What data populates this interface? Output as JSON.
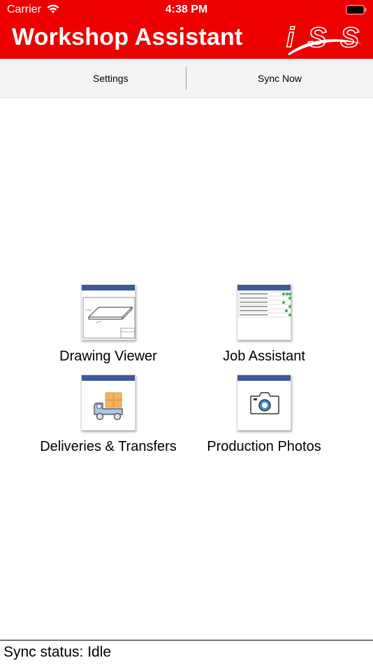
{
  "status_bar": {
    "carrier": "Carrier",
    "time": "4:38 PM"
  },
  "header": {
    "title": "Workshop Assistant",
    "logo_text": "iSS",
    "background": "#ee0000"
  },
  "toolbar": {
    "settings_label": "Settings",
    "sync_label": "Sync Now"
  },
  "tiles": [
    {
      "label": "Drawing Viewer",
      "icon": "drawing-icon"
    },
    {
      "label": "Job Assistant",
      "icon": "job-list-icon"
    },
    {
      "label": "Deliveries & Transfers",
      "icon": "delivery-truck-icon"
    },
    {
      "label": "Production Photos",
      "icon": "camera-icon"
    }
  ],
  "footer": {
    "sync_status": "Sync status: Idle"
  },
  "colors": {
    "accent_bar": "#3d5a99",
    "header_red": "#ee0000"
  }
}
